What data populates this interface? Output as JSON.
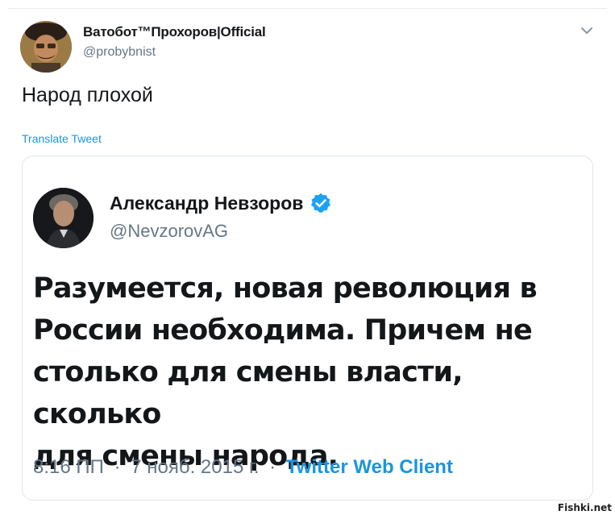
{
  "author": {
    "display_name": "Ватобот™Прохоров|Official",
    "handle": "@probybnist"
  },
  "tweet": {
    "text": "Народ плохой",
    "translate_label": "Translate Tweet"
  },
  "quoted_tweet": {
    "display_name": "Александр Невзоров",
    "handle": "@NevzorovAG",
    "verified": true,
    "text_lines": [
      "Разумеется, новая революция в",
      "России необходима. Причем не",
      "столько для смены власти, сколько",
      "для смены народа."
    ],
    "time": "8:16 ПП",
    "date": "7 нояб. 2015 г.",
    "separator": "·",
    "client": "Twitter Web Client"
  },
  "watermark": "Fishki.net",
  "colors": {
    "link": "#1b95e0",
    "secondary_text": "#657786",
    "primary_text": "#14171a",
    "border": "#dfe6ea"
  },
  "icons": {
    "menu": "chevron-down-icon",
    "verified": "verified-badge-icon"
  }
}
